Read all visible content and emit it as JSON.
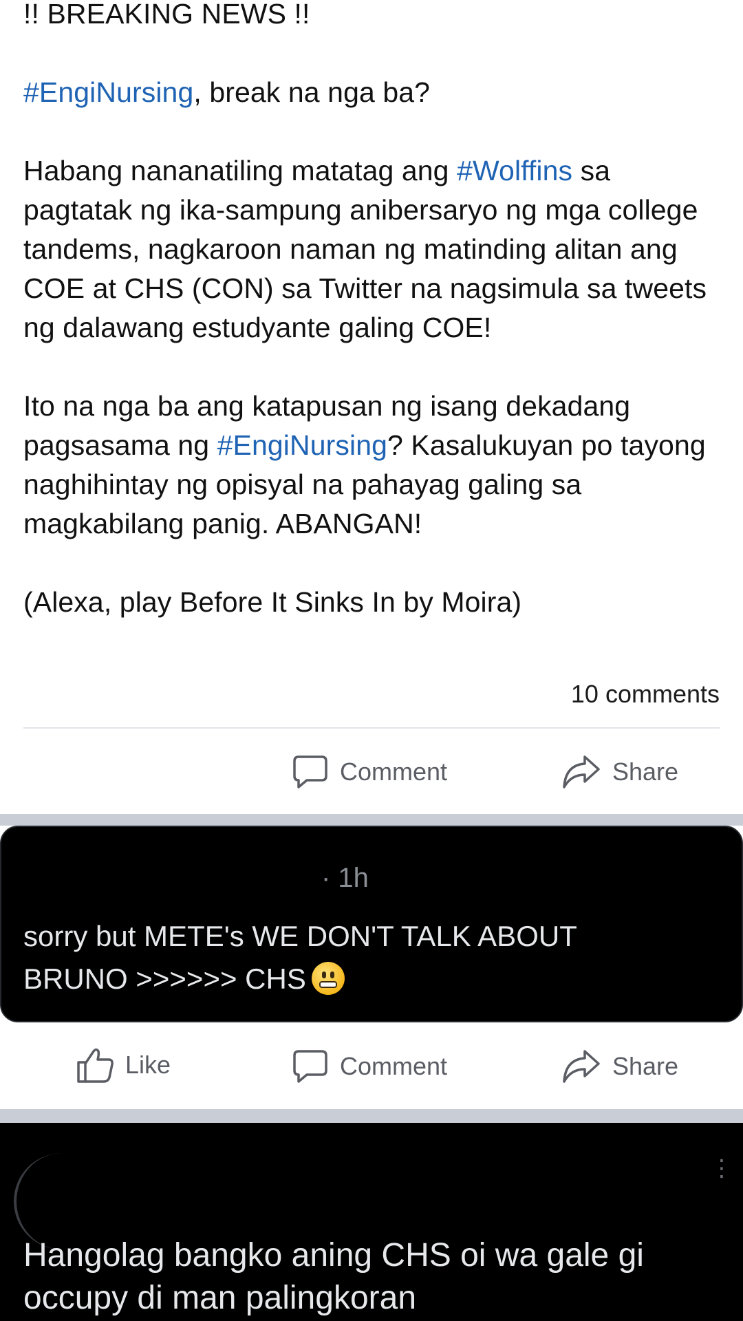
{
  "post": {
    "line1": "!! BREAKING NEWS !!",
    "line2_tag": "#EngiNursing",
    "line2_rest": ", break na nga ba?",
    "p2_a": "Habang nananatiling matatag ang ",
    "p2_tag": "#Wolffins",
    "p2_b": " sa pagtatak ng ika-sampung anibersaryo ng mga college tandems, nagkaroon naman ng matinding alitan ang COE at CHS (CON) sa Twitter na nagsimula sa tweets ng dalawang estudyante galing COE!",
    "p3_a": "Ito na nga ba ang katapusan ng isang dekadang pagsasama ng ",
    "p3_tag": "#EngiNursing",
    "p3_b": "? Kasalukuyan po tayong naghihintay ng opisyal na pahayag galing sa magkabilang panig. ABANGAN!",
    "p4": "(Alexa, play Before It Sinks In by Moira)",
    "comments_count": "10 comments"
  },
  "post_actions": {
    "comment_label": "Comment",
    "share_label": "Share"
  },
  "tweet1": {
    "time": "· 1h",
    "line1": "sorry but METE's WE DON'T TALK ABOUT",
    "line2": "BRUNO >>>>>> CHS",
    "emoji": "grimacing-face-emoji"
  },
  "tweet1_actions": {
    "like_label": "Like",
    "comment_label": "Comment",
    "share_label": "Share"
  },
  "tweet2": {
    "line1": "Hangolag bangko aning CHS oi wa gale gi",
    "line2": "occupy di man palingkoran",
    "more": "⋮"
  },
  "icons": {
    "comment": "comment-bubble-icon",
    "share": "share-arrow-icon",
    "like": "thumbs-up-icon",
    "more": "more-vertical-icon"
  },
  "colors": {
    "hashtag": "#1f63b4",
    "text": "#111111",
    "action_gray": "#5a5d63",
    "separator": "#c9ced6",
    "tweet_bg": "#000000"
  }
}
